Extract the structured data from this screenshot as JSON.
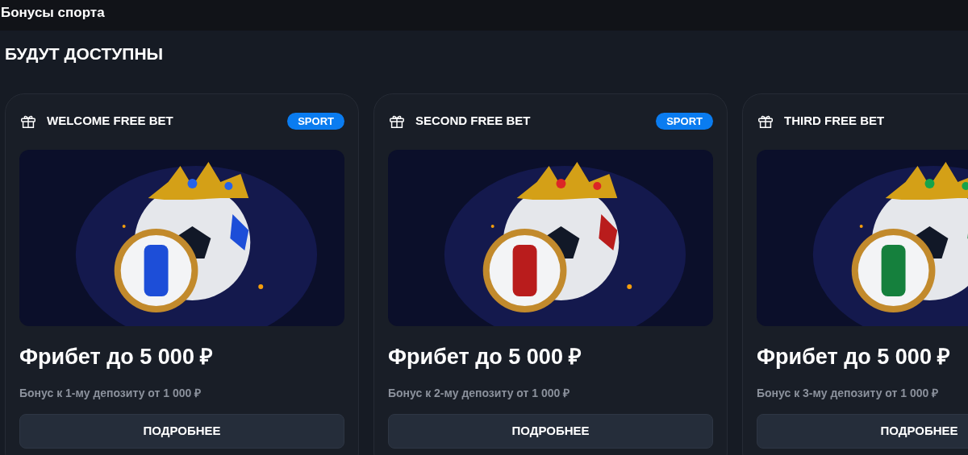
{
  "header": {
    "title": "Бонусы спорта"
  },
  "section": {
    "title": "БУДУТ ДОСТУПНЫ"
  },
  "cards": [
    {
      "name": "WELCOME FREE BET",
      "badge": "SPORT",
      "title": "Фрибет до 5 000 ₽",
      "subtitle": "Бонус к 1-му депозиту от 1 000 ₽",
      "button": "ПОДРОБНЕЕ"
    },
    {
      "name": "SECOND FREE BET",
      "badge": "SPORT",
      "title": "Фрибет до 5 000 ₽",
      "subtitle": "Бонус к 2-му депозиту от 1 000 ₽",
      "button": "ПОДРОБНЕЕ"
    },
    {
      "name": "THIRD FREE BET",
      "title": "Фрибет до 5 000 ₽",
      "subtitle": "Бонус к 3-му депозиту от 1 000 ₽",
      "button": "ПОДРОБНЕЕ"
    }
  ]
}
